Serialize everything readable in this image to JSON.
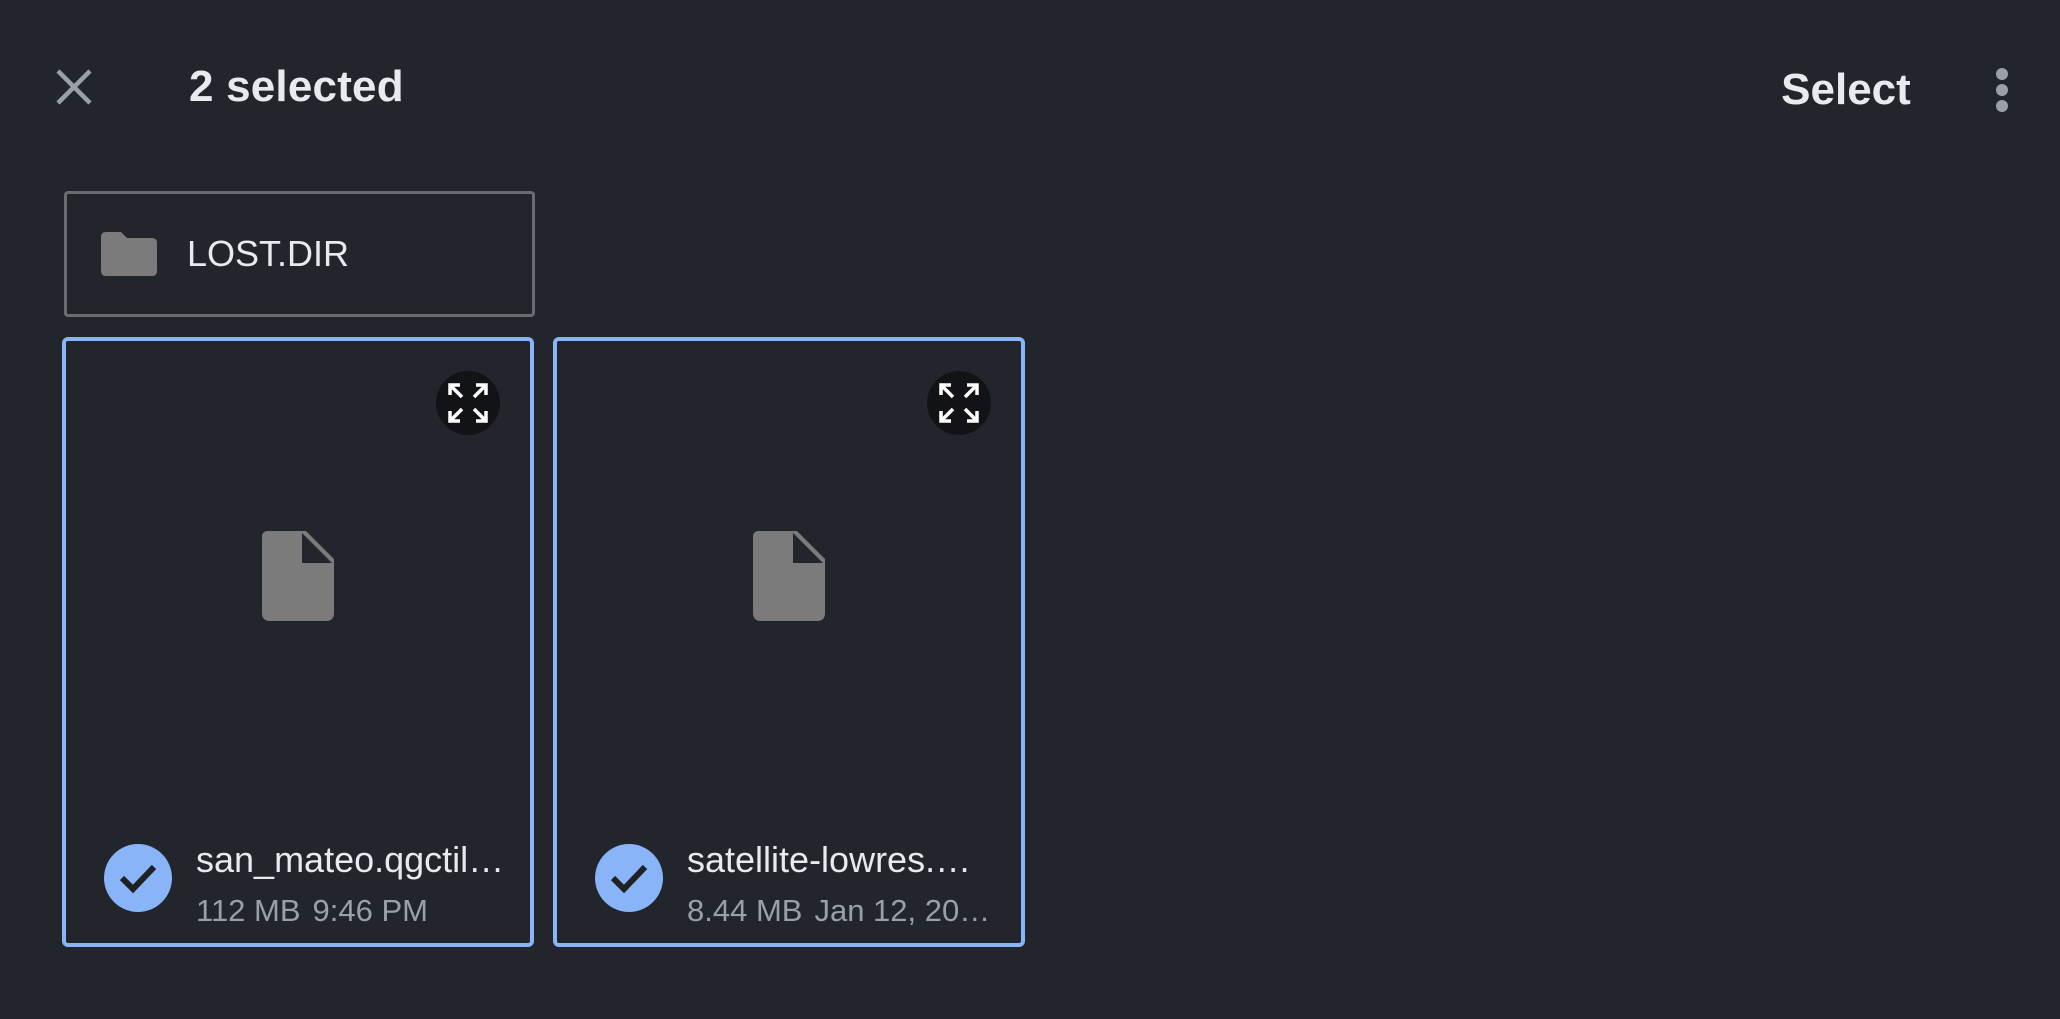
{
  "header": {
    "title": "2 selected",
    "select_label": "Select",
    "close_icon": "close-icon",
    "more_icon": "more-vert-icon"
  },
  "folders": [
    {
      "name": "LOST.DIR",
      "icon": "folder-icon"
    }
  ],
  "files": [
    {
      "name": "san_mateo.qgctil…",
      "size": "112 MB",
      "date": "9:46 PM",
      "selected": true,
      "icon": "document-icon"
    },
    {
      "name": "satellite-lowres.…",
      "size": "8.44 MB",
      "date": "Jan 12, 20…",
      "selected": true,
      "icon": "document-icon"
    }
  ],
  "colors": {
    "background": "#22252b",
    "accent": "#8ab4f8",
    "text": "#e8eaed",
    "secondary_text": "#9aa0a6",
    "icon_gray": "#7b7b7c"
  }
}
